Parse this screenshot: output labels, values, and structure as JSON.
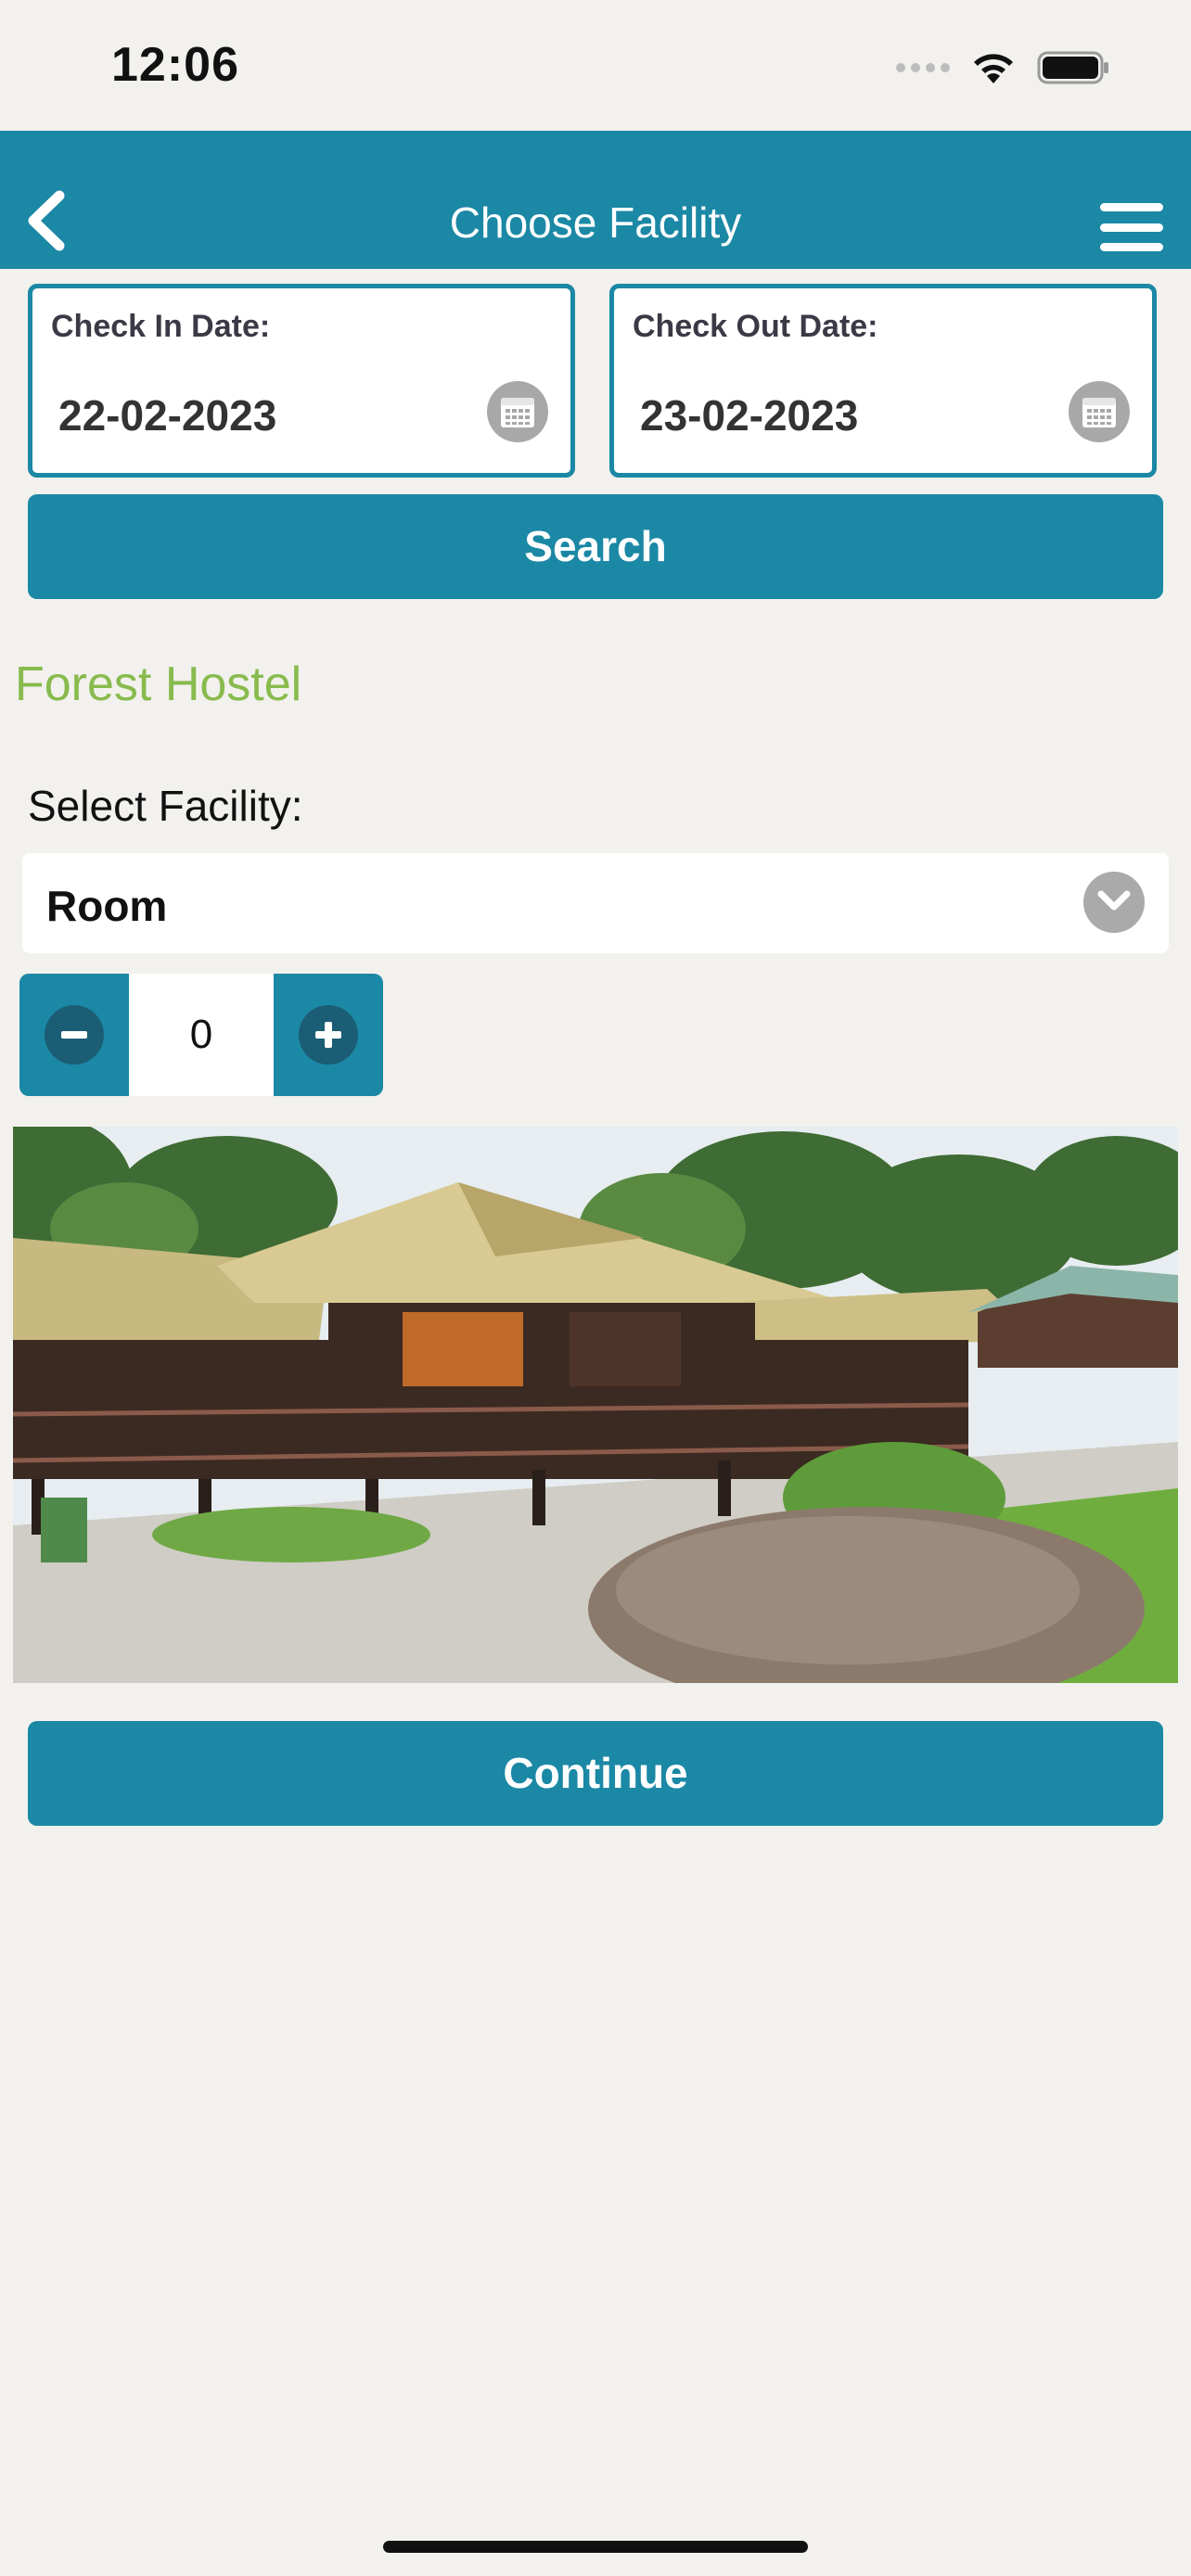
{
  "status_bar": {
    "time": "12:06",
    "icons": [
      "signal-icon",
      "wifi-icon",
      "battery-icon"
    ]
  },
  "header": {
    "title": "Choose Facility",
    "back_icon": "chevron-left-icon",
    "menu_icon": "hamburger-menu-icon"
  },
  "check_in": {
    "label": "Check In Date:",
    "value": "22-02-2023",
    "icon": "calendar-icon"
  },
  "check_out": {
    "label": "Check Out Date:",
    "value": "23-02-2023",
    "icon": "calendar-icon"
  },
  "search_button": {
    "label": "Search"
  },
  "hostel": {
    "name": "Forest Hostel"
  },
  "facility_select": {
    "label": "Select Facility:",
    "selected": "Room",
    "icon": "chevron-down-icon"
  },
  "quantity": {
    "value": "0",
    "minus_icon": "minus-icon",
    "plus_icon": "plus-icon"
  },
  "photo": {
    "subject": "forest-hostel-building-photo"
  },
  "continue_button": {
    "label": "Continue"
  },
  "colors": {
    "primary": "#1b88a5",
    "accent_green": "#88bb4d",
    "background": "#f2f1ee",
    "stepper_circle": "#1b5d74"
  }
}
